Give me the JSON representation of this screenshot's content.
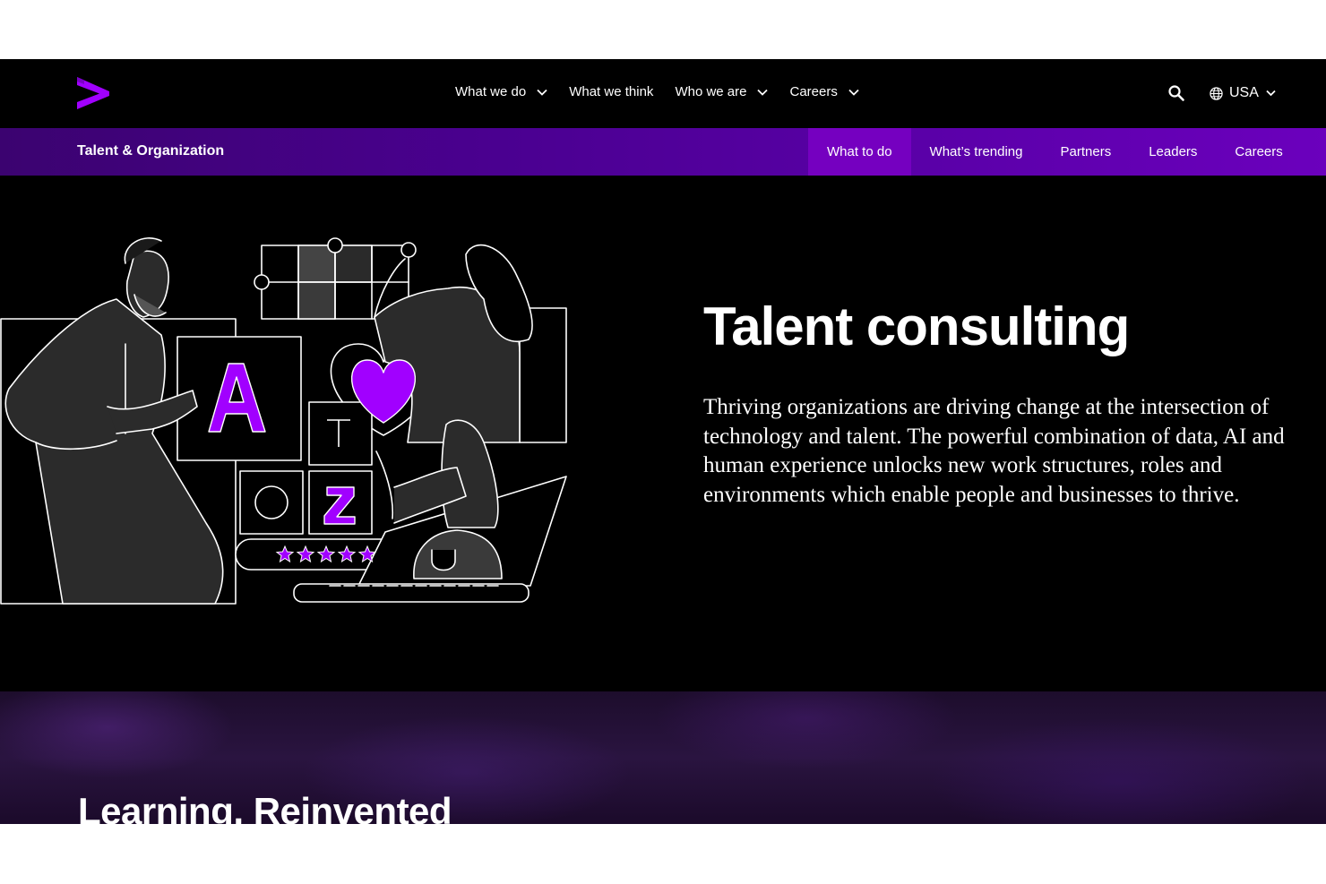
{
  "brand": {
    "accent": "#a100ff",
    "subnav_active": "#7500c0"
  },
  "topnav": {
    "menu": [
      {
        "label": "What we do",
        "has_dropdown": true
      },
      {
        "label": "What we think",
        "has_dropdown": false
      },
      {
        "label": "Who we are",
        "has_dropdown": true
      },
      {
        "label": "Careers",
        "has_dropdown": true
      }
    ],
    "locale": "USA",
    "icons": {
      "logo": "accenture-logo-icon",
      "search": "search-icon",
      "globe": "globe-icon"
    }
  },
  "subnav": {
    "title": "Talent & Organization",
    "tabs": [
      {
        "label": "What to do",
        "active": true
      },
      {
        "label": "What’s trending",
        "active": false
      },
      {
        "label": "Partners",
        "active": false
      },
      {
        "label": "Leaders",
        "active": false
      },
      {
        "label": "Careers",
        "active": false
      }
    ]
  },
  "hero": {
    "title": "Talent consulting",
    "description": "Thriving organizations are driving change at the intersection of technology and talent. The powerful combination of data, AI and human experience unlocks new work structures, roles and environments which enable people and businesses to thrive.",
    "illustration": {
      "letters": [
        "A",
        "Z",
        "T"
      ],
      "rating_stars": 5
    }
  },
  "section": {
    "title": "Learning, Reinvented"
  }
}
